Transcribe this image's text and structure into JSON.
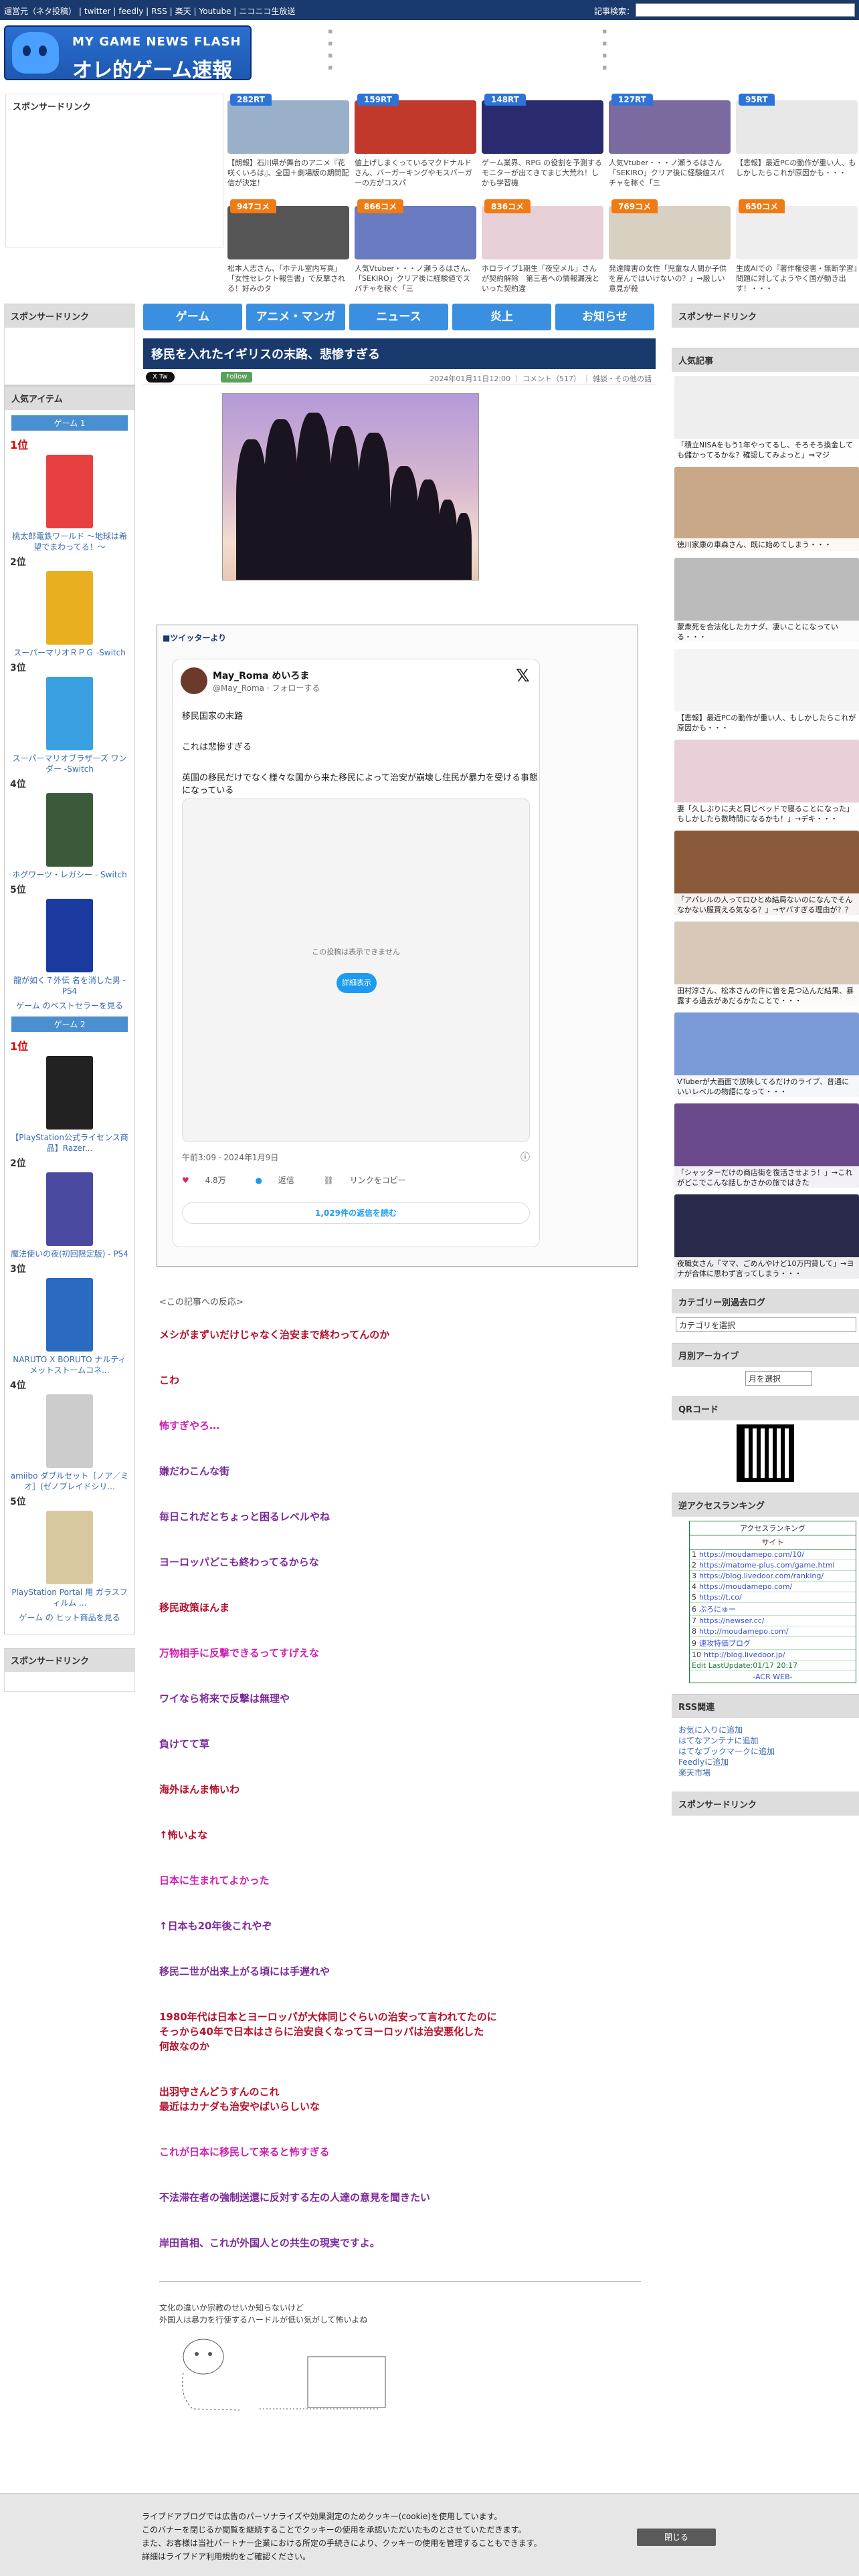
{
  "topbar": {
    "links": [
      "運営元（ネタ投稿）",
      "twitter",
      "feedly",
      "RSS",
      "楽天",
      "Youtube",
      "ニコニコ生放送"
    ],
    "search_label": "記事検索：",
    "search_placeholder": ""
  },
  "logo": {
    "sub": "MY GAME NEWS FLASH",
    "main": "オレ的ゲーム速報@JIN"
  },
  "sponsor_label": "スポンサードリンク",
  "thumbs_row1": [
    {
      "badge": "282RT",
      "cap": "【朗報】石川県が舞台のアニメ『花咲くいろは』、全国＋劇場版の期間配信が決定！",
      "color": "#9ab0c8"
    },
    {
      "badge": "159RT",
      "cap": "値上げしまくっているマクドナルドさん、バーガーキングやモスバーガーの方がコスパ",
      "color": "#c0392b"
    },
    {
      "badge": "148RT",
      "cap": "ゲーム業界、RPG の役割を予測するモニターが出てきてまじ大荒れ！しかも学習機",
      "color": "#2a2a6e"
    },
    {
      "badge": "127RT",
      "cap": "人気Vtuber・・・ノ瀬うるはさん「SEKIRO」クリア後に経験値スパチャを稼ぐ「三",
      "color": "#7a6aa0"
    },
    {
      "badge": "95RT",
      "cap": "【悲報】最近PCの動作が重い人、もしかしたらこれが原因かも・・・",
      "color": "#e8e8e8"
    }
  ],
  "thumbs_row2": [
    {
      "badge": "947コメ",
      "cap": "松本人志さん、「ホテル室内写真」「女性セレクト報告書」で反撃される！好みのタ",
      "color": "#555"
    },
    {
      "badge": "866コメ",
      "cap": "人気Vtuber・・・ノ瀬うるはさん、「SEKIRO」クリア後に経験値でスパチャを稼ぐ「三",
      "color": "#6a7ac0"
    },
    {
      "badge": "836コメ",
      "cap": "ホロライブ1期生「夜空メル」さんが契約解除　第三者への情報漏洩といった契約違",
      "color": "#e8d0d8"
    },
    {
      "badge": "769コメ",
      "cap": "発達障害の女性「児童な人間か子供を産んではいけないの？」→厳しい意見が殺",
      "color": "#d8d0c0"
    },
    {
      "badge": "650コメ",
      "cap": "生成AIでの『著作権侵害・無断学習』問題に対してようやく国が動き出す！・・・",
      "color": "#eee"
    }
  ],
  "nav": [
    "ゲーム",
    "アニメ・マンガ",
    "ニュース",
    "炎上",
    "お知らせ"
  ],
  "left": {
    "sponsor": "スポンサードリンク",
    "popular": "人気アイテム",
    "tab1": "ゲーム 1",
    "tab2": "ゲーム 2",
    "bottom_sponsor": "スポンサードリンク",
    "group1": [
      {
        "rank": "1位",
        "cap": "桃太郎電鉄ワールド ～地球は希望でまわってる！～",
        "color": "#e84040"
      },
      {
        "rank": "2位",
        "cap": "スーパーマリオＲＰＧ -Switch",
        "color": "#e8b020"
      },
      {
        "rank": "3位",
        "cap": "スーパーマリオブラザーズ ワンダー -Switch",
        "color": "#3aa0e0"
      },
      {
        "rank": "4位",
        "cap": "ホグワーツ・レガシー - Switch",
        "color": "#3a5a3a"
      },
      {
        "rank": "5位",
        "cap": "龍が如く７外伝 名を消した男 - PS4",
        "color": "#1a3aa0"
      }
    ],
    "more1": "ゲーム のベストセラーを見る",
    "group2": [
      {
        "rank": "1位",
        "cap": "【PlayStation公式ライセンス商品】Razer...",
        "color": "#222"
      },
      {
        "rank": "2位",
        "cap": "魔法使いの夜(初回限定版) - PS4",
        "color": "#4a4aa0"
      },
      {
        "rank": "3位",
        "cap": "NARUTO X BORUTO ナルティメットストームコネ...",
        "color": "#2a6ac0"
      },
      {
        "rank": "4位",
        "cap": "amiibo ダブルセット［ノア／ミオ］(ゼノブレイドシリ...",
        "color": "#ccc"
      },
      {
        "rank": "5位",
        "cap": "PlayStation Portal 用 ガラスフィルム ...",
        "color": "#d8c8a0"
      }
    ],
    "more2": "ゲーム の ヒット商品を見る"
  },
  "article": {
    "title": "移民を入れたイギリスの末路、悲惨すぎる",
    "tw_btn": "X Tw",
    "follow_btn": "Follow",
    "meta": "2024年01月11日12:00 ｜ コメント（517） ｜ 雑談・その他の話",
    "twitter_label": "■ツイッターより",
    "tweet": {
      "name": "May_Roma めいろま",
      "handle": "@May_Roma · フォローする",
      "lines": [
        "移民国家の末路",
        "これは悲惨すぎる",
        "英国の移民だけでなく様々な国から来た移民によって治安が崩壊し住民が暴力を受ける事態になっている"
      ],
      "media_msg": "この投稿は表示できません",
      "media_btn": "詳細表示",
      "time": "午前3:09 · 2024年1月9日",
      "likes": "4.8万",
      "reply": "返信",
      "link": "リンクをコピー",
      "more": "1,029件の返信を読む"
    },
    "reactions_head": "<この記事への反応>",
    "comments": [
      {
        "text": "メシがまずいだけじゃなく治安まで終わってんのか",
        "color": "#b8102a"
      },
      {
        "text": "こわ",
        "color": "#b8102a"
      },
      {
        "text": "怖すぎやろ…",
        "color": "#d020b0"
      },
      {
        "text": "嫌だわこんな街",
        "color": "#7a2a9a"
      },
      {
        "text": "毎日これだとちょっと困るレベルやね",
        "color": "#7a2a9a"
      },
      {
        "text": "ヨーロッパどこも終わってるからな",
        "color": "#7a2a9a"
      },
      {
        "text": "移民政策ほんま",
        "color": "#b8102a"
      },
      {
        "text": "万物相手に反撃できるってすげえな",
        "color": "#d020b0"
      },
      {
        "text": "ワイなら将来で反撃は無理や",
        "color": "#7a2a9a"
      },
      {
        "text": "負けてて草",
        "color": "#7a2a9a"
      },
      {
        "text": "海外ほんま怖いわ",
        "color": "#b8102a"
      },
      {
        "text": "↑怖いよな",
        "color": "#b8102a"
      },
      {
        "text": "日本に生まれてよかった",
        "color": "#d020b0"
      },
      {
        "text": "↑日本も20年後これやぞ",
        "color": "#7a2a9a"
      },
      {
        "text": "移民二世が出来上がる頃には手遅れや",
        "color": "#7a2a9a"
      },
      {
        "text": "1980年代は日本とヨーロッパが大体同じぐらいの治安って言われてたのに\nそっから40年で日本はさらに治安良くなってヨーロッパは治安悪化した\n何故なのか",
        "color": "#b8102a"
      },
      {
        "text": "出羽守さんどうすんのこれ\n最近はカナダも治安やばいらしいな",
        "color": "#b8102a"
      },
      {
        "text": "これが日本に移民して来ると怖すぎる",
        "color": "#d020b0"
      },
      {
        "text": "不法滞在者の強制送還に反対する左の人達の意見を聞きたい",
        "color": "#7a2a9a"
      },
      {
        "text": "岸田首相、これが外国人との共生の現実ですよ。",
        "color": "#7a2a9a"
      }
    ],
    "aa_text": "文化の違いか宗教のせいか知らないけど\n外国人は暴力を行使するハードルが低い気がして怖いよね"
  },
  "right": {
    "sponsor": "スポンサードリンク",
    "popular": "人気記事",
    "items": [
      {
        "cap": "「積立NISAをもう1年やってるし、そろそろ換金しても儲かってるかな？確認してみよっと」⇒マジか・・・",
        "color": "#eee"
      },
      {
        "cap": "徳川家康の車森さん、既に始めてしまう・・・",
        "color": "#c9a88a"
      },
      {
        "cap": "蒙衆死を合法化したカナダ、凄いことになっている・・・",
        "color": "#bbb"
      },
      {
        "cap": "【悲報】最近PCの動作が重い人、もしかしたらこれが原因かも・・・",
        "color": "#f4f4f4"
      },
      {
        "cap": "妻「久しぶりに夫と同じベッドで寝ることになった」もしかしたら数時間になるかも！」→デキ・・・",
        "color": "#e9d0d8"
      },
      {
        "cap": "「アパレルの人って口ひとぬ結局ないのになんでそんなかない服買える気なる？」→ヤバすぎる理由が？？",
        "color": "#8a5a3a"
      },
      {
        "cap": "田村淳さん、松本さんの件に曽を見つ込んだ結果、暴露する過去があだるかたことで・・・",
        "color": "#d8c8b8"
      },
      {
        "cap": "VTuberが大画面で放映してるだけのライブ、普通にいいレベルの物語になって・・・",
        "color": "#7a9ad8"
      },
      {
        "cap": "「シャッターだけの商店街を復活させよう！」→これがどこでこんな話しかさかの旅ではきた",
        "color": "#6a4a8a"
      },
      {
        "cap": "夜職女さん「ママ、ごめんやけど10万円貸して」→ヨナが合体に思わず言ってしまう・・・",
        "color": "#2a2a4a"
      }
    ],
    "cat_head": "カテゴリー別過去ログ",
    "cat_select": "カテゴリを選択",
    "archive_head": "月別アーカイブ",
    "archive_select": "月を選択",
    "qr_head": "QRコード",
    "access_head": "逆アクセスランキング",
    "access_title": "アクセスランキング",
    "access_site": "サイト",
    "access_rows": [
      {
        "n": "1",
        "url": "https://moudamepo.com/10/"
      },
      {
        "n": "2",
        "url": "https://matome-plus.com/game.html"
      },
      {
        "n": "3",
        "url": "https://blog.livedoor.com/ranking/"
      },
      {
        "n": "4",
        "url": "https://moudamepo.com/"
      },
      {
        "n": "5",
        "url": "https://t.co/"
      },
      {
        "n": "6",
        "url": "ぷろにゅー"
      },
      {
        "n": "7",
        "url": "https://newser.cc/"
      },
      {
        "n": "8",
        "url": "http://moudamepo.com/"
      },
      {
        "n": "9",
        "url": "速攻特価ブログ"
      },
      {
        "n": "10",
        "url": "http://blog.livedoor.jp/"
      }
    ],
    "access_update": "Edit LastUpdate:01/17 20:17",
    "access_foot": "-ACR WEB-",
    "rss_head": "RSS関連",
    "rss_links": [
      "お気に入りに追加",
      "はてなアンテナに追加",
      "はてなブックマークに追加",
      "Feedlyに追加",
      "楽天市場"
    ],
    "bottom_sponsor": "スポンサードリンク"
  },
  "header_links_col1": [
    "",
    "",
    "",
    ""
  ],
  "cookie": {
    "lines": [
      "ライブドアブログでは広告のパーソナライズや効果測定のためクッキー(cookie)を使用しています。",
      "このバナーを閉じるか閲覧を継続することでクッキーの使用を承認いただいたものとさせていただきます。",
      "また、お客様は当社パートナー企業における所定の手続きにより、クッキーの使用を管理することもできます。",
      "詳細はライブドア利用規約をご確認ください。"
    ],
    "close": "閉じる"
  }
}
